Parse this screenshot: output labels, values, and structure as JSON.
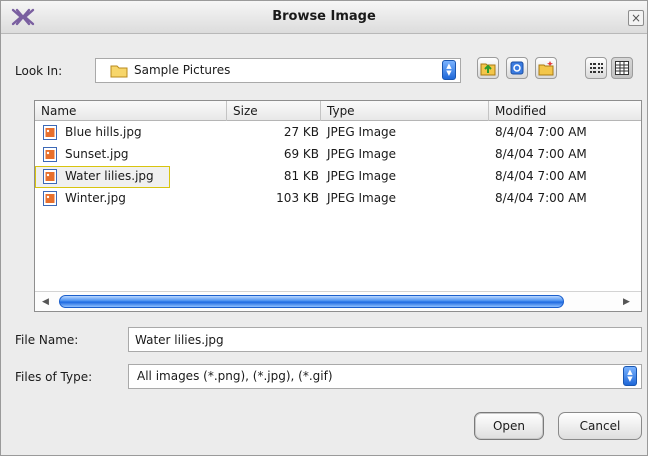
{
  "window": {
    "title": "Browse Image",
    "close_label": "×"
  },
  "look_in": {
    "label": "Look In:",
    "value": "Sample Pictures"
  },
  "toolbar": [
    {
      "name": "up-folder-button",
      "icon": "up-folder-icon"
    },
    {
      "name": "home-button",
      "icon": "home-icon"
    },
    {
      "name": "new-folder-button",
      "icon": "new-folder-icon"
    },
    {
      "name": "list-view-button",
      "icon": "list-view-icon"
    },
    {
      "name": "details-view-button",
      "icon": "details-view-icon"
    }
  ],
  "file_list": {
    "columns": [
      "Name",
      "Size",
      "Type",
      "Modified"
    ],
    "rows": [
      {
        "name": "Blue hills.jpg",
        "size": "27 KB",
        "type": "JPEG Image",
        "modified": "8/4/04 7:00 AM"
      },
      {
        "name": "Sunset.jpg",
        "size": "69 KB",
        "type": "JPEG Image",
        "modified": "8/4/04 7:00 AM"
      },
      {
        "name": "Water lilies.jpg",
        "size": "81 KB",
        "type": "JPEG Image",
        "modified": "8/4/04 7:00 AM",
        "selected": true
      },
      {
        "name": "Winter.jpg",
        "size": "103 KB",
        "type": "JPEG Image",
        "modified": "8/4/04 7:00 AM"
      }
    ]
  },
  "file_name": {
    "label": "File Name:",
    "value": "Water lilies.jpg"
  },
  "file_type": {
    "label": "Files of Type:",
    "value": "All images (*.png), (*.jpg), (*.gif)"
  },
  "buttons": {
    "open": "Open",
    "cancel": "Cancel"
  },
  "colors": {
    "accent": "#1c68e0",
    "selection_border": "#d8c40f"
  }
}
